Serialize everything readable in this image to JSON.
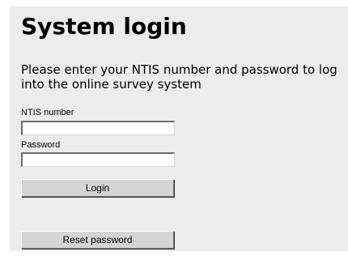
{
  "title": "System login",
  "intro": "Please enter your NTIS number and password to log into the online survey system",
  "form": {
    "ntis_label": "NTIS number",
    "ntis_value": "",
    "password_label": "Password",
    "password_value": "",
    "login_label": "Login",
    "reset_label": "Reset password"
  },
  "colors": {
    "panel_background": "#ececec",
    "button_face": "#d4d4d4",
    "input_background": "#ffffff"
  }
}
